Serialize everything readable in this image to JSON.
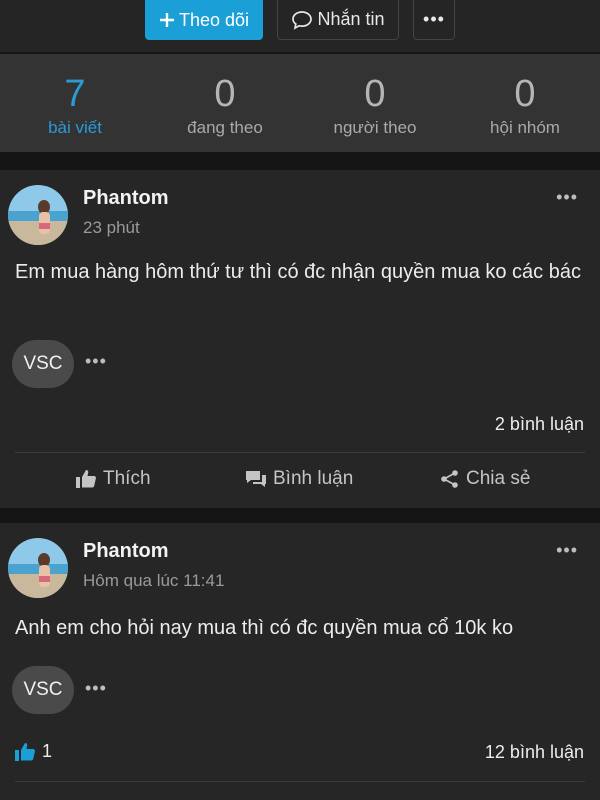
{
  "toolbar": {
    "follow_label": "Theo dõi",
    "message_label": "Nhắn tin",
    "more_label": "•••"
  },
  "stats": [
    {
      "value": "7",
      "label": "bài viết"
    },
    {
      "value": "0",
      "label": "đang theo"
    },
    {
      "value": "0",
      "label": "người theo"
    },
    {
      "value": "0",
      "label": "hội nhóm"
    }
  ],
  "posts": [
    {
      "author": "Phantom",
      "time": "23 phút",
      "text": "Em mua hàng hôm thứ tư thì có đc nhận quyền mua ko các bác",
      "tag": "VSC",
      "comments": "2 bình luận",
      "actions": {
        "like": "Thích",
        "comment": "Bình luận",
        "share": "Chia sẻ"
      }
    },
    {
      "author": "Phantom",
      "time": "Hôm qua lúc 11:41",
      "text": "Anh em cho hỏi nay mua thì có đc quyền mua cổ 10k ko",
      "tag": "VSC",
      "likes": "1",
      "comments": "12 bình luận"
    }
  ],
  "colors": {
    "accent": "#1a9fd6",
    "active_stat": "#2b9ad6",
    "card_bg": "#262626",
    "stats_bg": "#333333"
  },
  "icons": [
    "plus-icon",
    "chat-bubble-icon",
    "more-dots-icon",
    "thumbs-up-icon",
    "comment-icon",
    "share-icon"
  ]
}
